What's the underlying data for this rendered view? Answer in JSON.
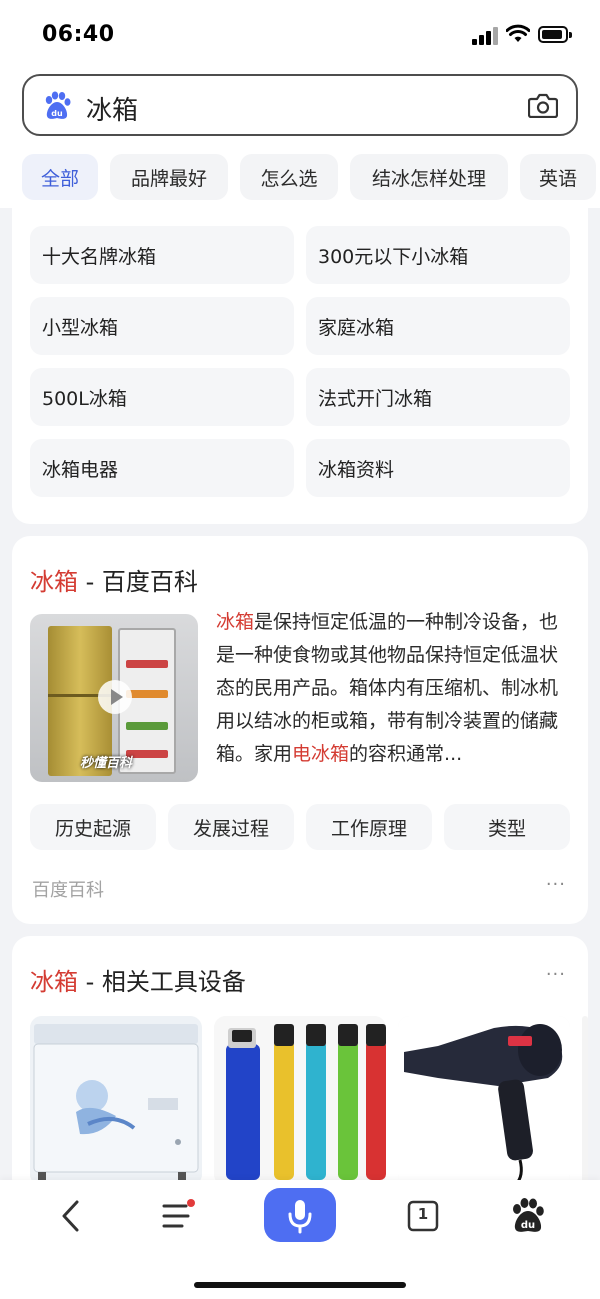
{
  "status_bar": {
    "time": "06:40"
  },
  "search": {
    "query": "冰箱"
  },
  "tabs": [
    {
      "label": "全部",
      "active": true
    },
    {
      "label": "品牌最好"
    },
    {
      "label": "怎么选"
    },
    {
      "label": "结冰怎样处理"
    },
    {
      "label": "英语"
    }
  ],
  "related_searches": [
    "十大名牌冰箱",
    "300元以下小冰箱",
    "小型冰箱",
    "家庭冰箱",
    "500L冰箱",
    "法式开门冰箱",
    "冰箱电器",
    "冰箱资料"
  ],
  "baike": {
    "title_hl": "冰箱",
    "title_rest": " - 百度百科",
    "thumb_watermark": "秒懂百科",
    "desc_hl1": "冰箱",
    "desc_part1": "是保持恒定低温的一种制冷设备，也是一种使食物或其他物品保持恒定低温状态的民用产品。箱体内有压缩机、制冰机用以结冰的柜或箱，带有制冷装置的储藏箱。家用",
    "desc_hl2": "电冰箱",
    "desc_part2": "的容积通常...",
    "chips": [
      "历史起源",
      "发展过程",
      "工作原理",
      "类型"
    ],
    "source": "百度百科",
    "more": "···"
  },
  "tools": {
    "title_hl": "冰箱",
    "title_rest": " - 相关工具设备",
    "more": "···",
    "items": [
      "chest-freezer-image",
      "lighters-image",
      "hair-dryer-image",
      "partial-product-image"
    ]
  },
  "bottom_nav": {
    "tab_count": "1"
  },
  "colors": {
    "highlight": "#d43c33",
    "accent": "#4e6ef2",
    "active_tab": "#3f5fd9"
  }
}
